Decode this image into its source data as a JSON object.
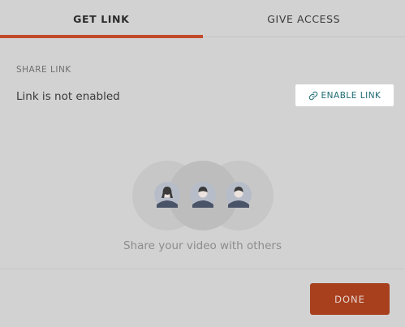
{
  "tabs": [
    {
      "label": "GET LINK",
      "active": true
    },
    {
      "label": "GIVE ACCESS",
      "active": false
    }
  ],
  "share": {
    "section_label": "SHARE LINK",
    "status": "Link is not enabled",
    "enable_button_label": "ENABLE LINK",
    "enable_icon": "link-icon"
  },
  "empty_state": {
    "illustration_icon": "people-group-icon",
    "message": "Share your video with others"
  },
  "footer": {
    "done_label": "DONE"
  },
  "colors": {
    "accent": "#c24a2a",
    "done_button": "#a8401e",
    "link_text": "#1e6b73",
    "overlay_background": "#d2d2d2"
  }
}
